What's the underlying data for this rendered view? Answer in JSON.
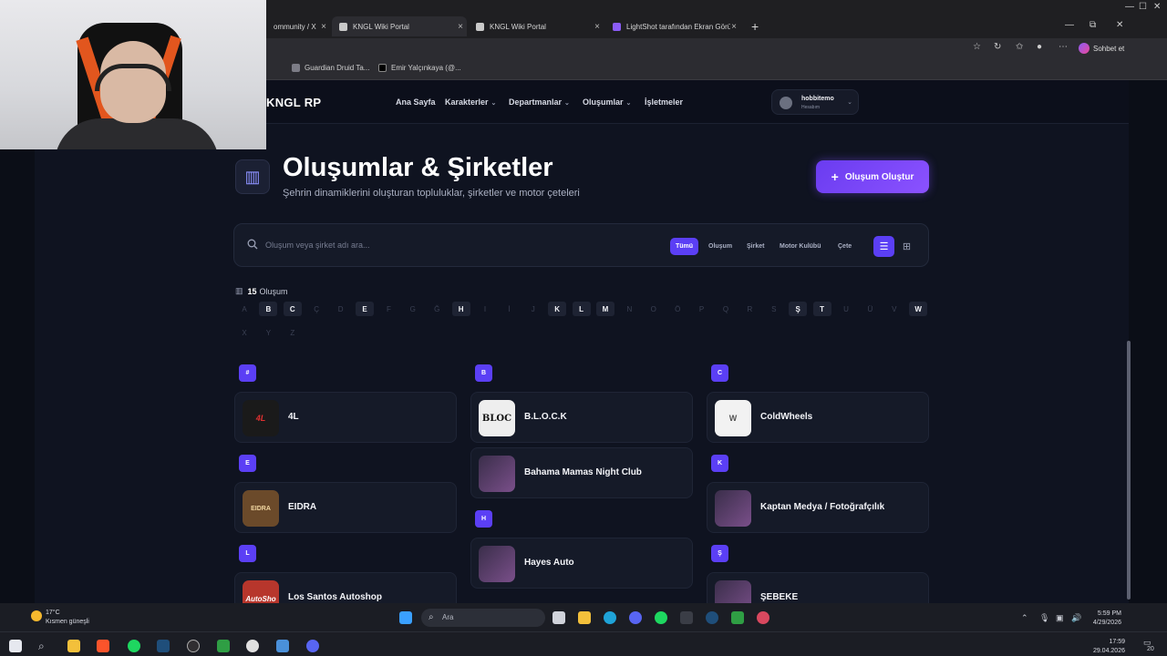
{
  "browser": {
    "tabs": [
      {
        "label": "ommunity / X"
      },
      {
        "label": "KNGL Wiki Portal"
      },
      {
        "label": "KNGL Wiki Portal"
      },
      {
        "label": "LightShot tarafından Ekran Görünt"
      }
    ],
    "bookmarks": [
      "Guardian Druid Ta...",
      "Emir Yalçınkaya (@..."
    ],
    "copilot_label": "Sohbet et"
  },
  "site": {
    "logo": "KNGL RP",
    "nav": [
      {
        "label": "Ana Sayfa"
      },
      {
        "label": "Karakterler"
      },
      {
        "label": "Departmanlar"
      },
      {
        "label": "Oluşumlar"
      },
      {
        "label": "İşletmeler"
      }
    ],
    "user": {
      "name": "hobbitemo",
      "status": "Hesabım"
    }
  },
  "hero": {
    "title": "Oluşumlar & Şirketler",
    "subtitle": "Şehrin dinamiklerini oluşturan topluluklar, şirketler ve motor çeteleri",
    "create_button": "Oluşum Oluştur"
  },
  "search": {
    "placeholder": "Oluşum veya şirket adı ara...",
    "filters": [
      "Tümü",
      "Oluşum",
      "Şirket",
      "Motor Kulübü",
      "Çete"
    ],
    "active_filter": "Tümü",
    "view": "list"
  },
  "summary": {
    "count": "15",
    "label": "Oluşum"
  },
  "alphabet": {
    "row1": [
      "A",
      "B",
      "C",
      "Ç",
      "D",
      "E",
      "F",
      "G",
      "Ğ",
      "H",
      "I",
      "İ",
      "J",
      "K",
      "L",
      "M",
      "N",
      "O",
      "Ö",
      "P",
      "Q",
      "R",
      "S",
      "Ş",
      "T",
      "U",
      "Ü",
      "V",
      "W"
    ],
    "row2": [
      "X",
      "Y",
      "Z"
    ],
    "enabled": [
      "B",
      "C",
      "E",
      "H",
      "K",
      "L",
      "M",
      "Ş",
      "T",
      "W"
    ]
  },
  "groups": {
    "col1": [
      {
        "letter": "#",
        "items": [
          {
            "name": "4L",
            "logo": "4L"
          }
        ]
      },
      {
        "letter": "E",
        "items": [
          {
            "name": "EIDRA",
            "logo": "EIDRA"
          }
        ]
      },
      {
        "letter": "L",
        "items": [
          {
            "name": "Los Santos Autoshop",
            "logo": "AutoSho"
          }
        ]
      }
    ],
    "col2": [
      {
        "letter": "B",
        "items": [
          {
            "name": "B.L.O.C.K",
            "logo": "BLOC"
          },
          {
            "name": "Bahama Mamas Night Club",
            "logo": ""
          }
        ]
      },
      {
        "letter": "H",
        "items": [
          {
            "name": "Hayes Auto",
            "logo": ""
          }
        ]
      }
    ],
    "col3": [
      {
        "letter": "C",
        "items": [
          {
            "name": "ColdWheels",
            "logo": "W"
          }
        ]
      },
      {
        "letter": "K",
        "items": [
          {
            "name": "Kaptan Medya / Fotoğrafçılık",
            "logo": ""
          }
        ]
      },
      {
        "letter": "Ş",
        "items": [
          {
            "name": "ŞEBEKE",
            "logo": ""
          }
        ]
      }
    ]
  },
  "taskbar": {
    "weather_temp": "17°C",
    "weather_desc": "Kısmen güneşli",
    "search_label": "Ara",
    "time1": "5:59 PM",
    "date1": "4/29/2026",
    "time2": "17:59",
    "date2": "29.04.2026",
    "notif_count": "20"
  }
}
